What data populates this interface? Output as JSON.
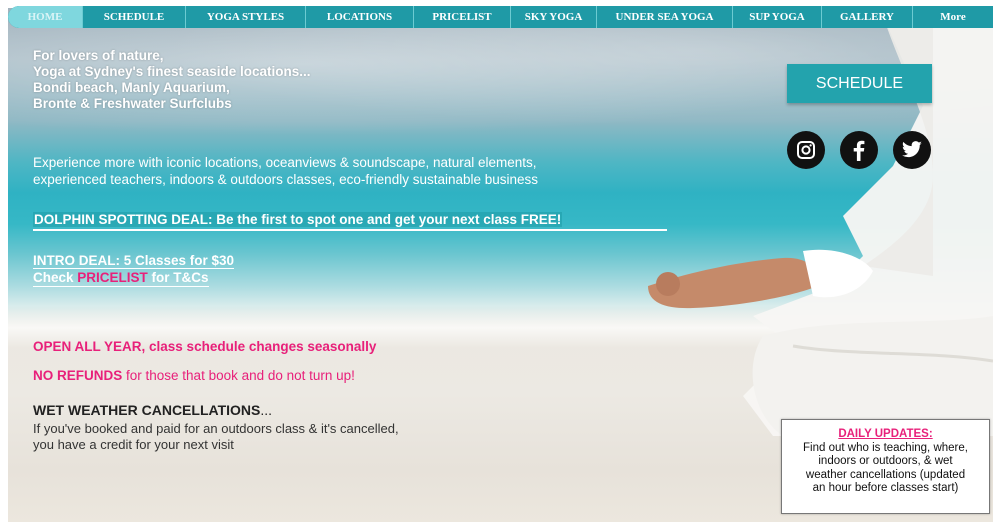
{
  "nav": {
    "items": [
      {
        "label": "HOME",
        "key": "home"
      },
      {
        "label": "SCHEDULE",
        "key": "schedule"
      },
      {
        "label": "YOGA STYLES",
        "key": "yoga-styles"
      },
      {
        "label": "LOCATIONS",
        "key": "locations"
      },
      {
        "label": "PRICELIST",
        "key": "pricelist"
      },
      {
        "label": "SKY YOGA",
        "key": "sky-yoga"
      },
      {
        "label": "UNDER SEA YOGA",
        "key": "under-sea-yoga"
      },
      {
        "label": "SUP YOGA",
        "key": "sup-yoga"
      },
      {
        "label": "GALLERY",
        "key": "gallery"
      },
      {
        "label": "More",
        "key": "more"
      }
    ]
  },
  "intro": {
    "line1": "For lovers of nature,",
    "line2": "Yoga at Sydney's finest seaside locations...",
    "line3": "Bondi beach, Manly Aquarium,",
    "line4": "Bronte & Freshwater Surfclubs"
  },
  "experience": {
    "line1": "Experience more with iconic locations, oceanviews & soundscape, natural elements,",
    "line2": "experienced teachers, indoors & outdoors classes, eco-friendly sustainable business"
  },
  "dolphin_deal": "DOLPHIN SPOTTING DEAL: Be the first to spot one and get your next class FREE!",
  "intro_deal": {
    "line1": "INTRO DEAL: 5 Classes for $30",
    "check": "Check ",
    "pricelist_link": "PRICELIST",
    "tcs": " for T&Cs"
  },
  "notices": {
    "open_all_year": "OPEN ALL YEAR, class schedule changes seasonally",
    "no_refunds_bold": "NO REFUNDS",
    "no_refunds_rest": " for those that book and do not turn up!"
  },
  "wet_weather": {
    "heading": "WET WEATHER CANCELLATIONS",
    "ellipsis": "...",
    "line1": "If you've booked and paid for an outdoors class & it's cancelled,",
    "line2": "you have a credit for your next visit"
  },
  "schedule_button": "SCHEDULE",
  "social": [
    {
      "icon": "instagram-icon"
    },
    {
      "icon": "facebook-icon"
    },
    {
      "icon": "twitter-icon"
    }
  ],
  "updates": {
    "heading": "DAILY UPDATES:",
    "line1": "Find out who is teaching, where,",
    "line2": "indoors or outdoors, & wet",
    "line3": "weather cancellations (updated",
    "line4": "an hour before classes start)"
  },
  "colors": {
    "nav_bg": "#1f9aa6",
    "button_bg": "#23a3ad",
    "accent_pink": "#e8207a"
  }
}
